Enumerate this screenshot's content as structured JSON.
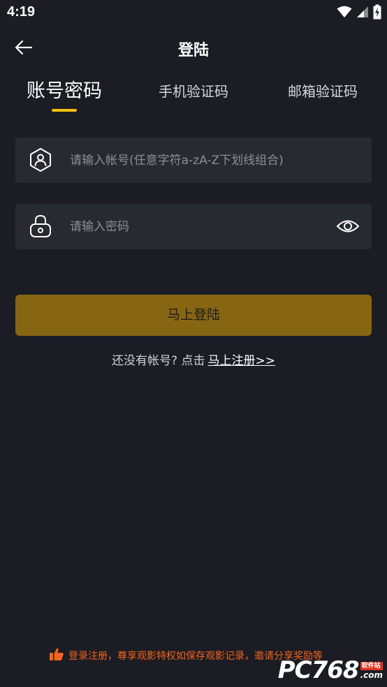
{
  "status_bar": {
    "time": "4:19",
    "icons": [
      "wifi-icon",
      "cellular-signal-icon",
      "battery-charging-icon"
    ]
  },
  "header": {
    "title": "登陆",
    "back_icon": "arrow-left-icon"
  },
  "tabs": [
    {
      "label": "账号密码",
      "active": true
    },
    {
      "label": "手机验证码",
      "active": false
    },
    {
      "label": "邮箱验证码",
      "active": false
    }
  ],
  "colors": {
    "background": "#1b1c24",
    "field_background": "#282a31",
    "accent": "#f2c012",
    "login_button": "#866513",
    "promo_text": "#f4631b"
  },
  "form": {
    "account": {
      "placeholder": "请输入帐号(任意字符a-zA-Z下划线组合)",
      "value": "",
      "icon": "user-shield-icon"
    },
    "password": {
      "placeholder": "请输入密码",
      "value": "",
      "icon": "lock-icon",
      "toggle_icon": "eye-icon"
    },
    "login_label": "马上登陆"
  },
  "register": {
    "prompt": "还没有帐号? 点击",
    "link_label": "马上注册>>"
  },
  "promo": {
    "icon": "thumbs-up-icon",
    "text": "登录注册，尊享观影特权如保存观影记录，邀请分享奖励等"
  },
  "watermark": {
    "main": "PC768",
    "badge": "软件站",
    "domain": ".com"
  }
}
